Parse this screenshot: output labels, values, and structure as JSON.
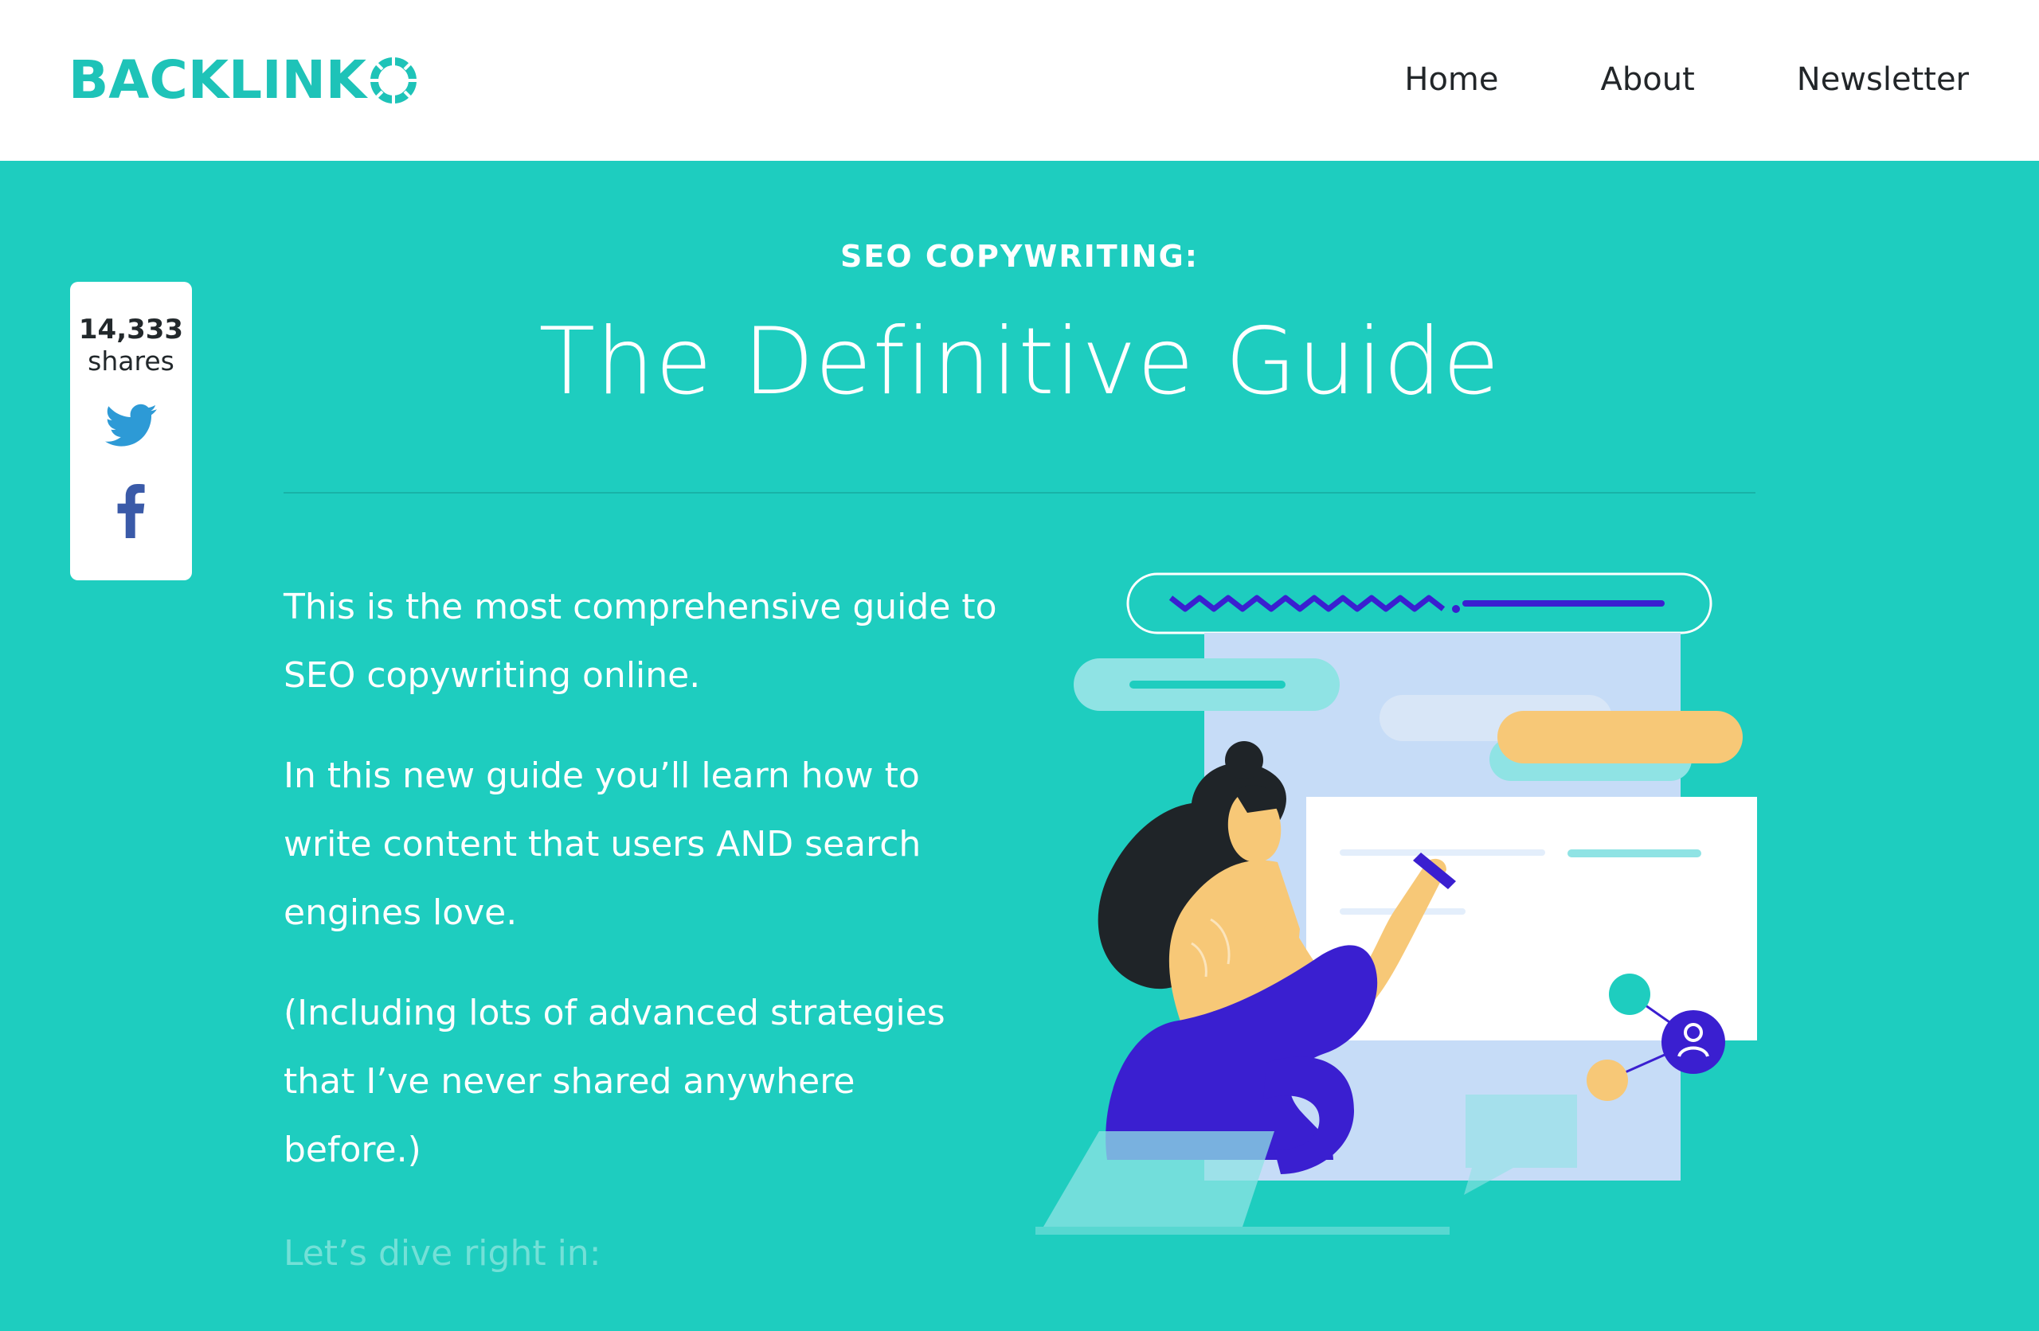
{
  "header": {
    "logo_text": "BACKLINK",
    "nav": {
      "home": "Home",
      "about": "About",
      "newsletter": "Newsletter"
    }
  },
  "share": {
    "count": "14,333",
    "label": "shares",
    "icons": [
      "twitter-icon",
      "facebook-icon"
    ]
  },
  "hero": {
    "kicker": "SEO COPYWRITING:",
    "title": "The Definitive Guide"
  },
  "intro": {
    "p1": "This is the most comprehensive guide to SEO copywriting online.",
    "p2": "In this new guide you’ll learn how to write content that users AND search engines love.",
    "p3": "(Including lots of advanced strategies that I’ve never shared anywhere before.)",
    "p4": "Let’s dive right in:"
  },
  "colors": {
    "brand": "#1ec3b8",
    "background": "#1ecdbf",
    "twitter": "#2d9ad6",
    "facebook": "#3a5aa8",
    "illustration_purple": "#3a1fd0",
    "illustration_yellow": "#f7c877"
  }
}
